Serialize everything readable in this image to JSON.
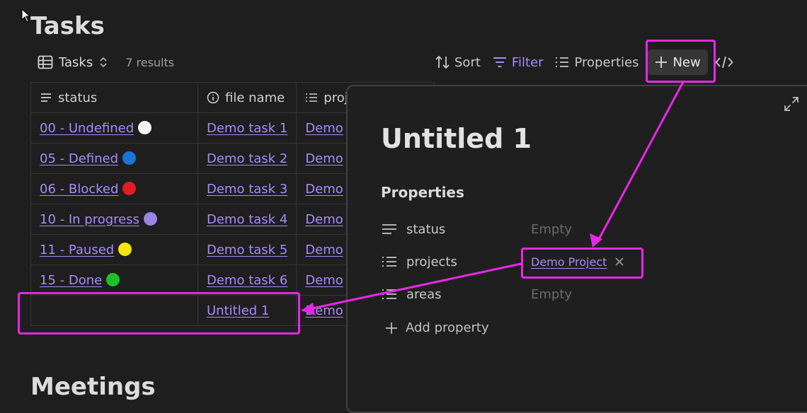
{
  "page": {
    "title": "Tasks",
    "next_section_title": "Meetings"
  },
  "toolbar": {
    "view_name": "Tasks",
    "results": "7 results",
    "sort_label": "Sort",
    "filter_label": "Filter",
    "properties_label": "Properties",
    "new_label": "New"
  },
  "table": {
    "headers": [
      "status",
      "file name",
      "proj"
    ],
    "rows": [
      {
        "status": "00 - Undefined",
        "dot": "#f5f5f5",
        "file": "Demo task 1",
        "project": "Demo"
      },
      {
        "status": "05 - Defined",
        "dot": "#1a74d8",
        "file": "Demo task 2",
        "project": "Demo"
      },
      {
        "status": "06 - Blocked",
        "dot": "#e01b24",
        "file": "Demo task 3",
        "project": "Demo"
      },
      {
        "status": "10 - In progress",
        "dot": "#9a85e6",
        "file": "Demo task 4",
        "project": "Demo"
      },
      {
        "status": "11 - Paused",
        "dot": "#f5e50f",
        "file": "Demo task 5",
        "project": "Demo"
      },
      {
        "status": "15 - Done",
        "dot": "#1fbf2a",
        "file": "Demo task 6",
        "project": "Demo"
      },
      {
        "status": "",
        "dot": "",
        "file": "Untitled 1",
        "project": "Demo"
      }
    ]
  },
  "panel": {
    "title": "Untitled 1",
    "properties_heading": "Properties",
    "properties": [
      {
        "key": "status",
        "value": "Empty"
      },
      {
        "key": "projects",
        "value": "Demo Project"
      },
      {
        "key": "areas",
        "value": "Empty"
      }
    ],
    "add_property_label": "Add property"
  },
  "colors": {
    "accent": "#a78bfa",
    "annotation": "#e628e6",
    "background": "#1e1e1e"
  }
}
